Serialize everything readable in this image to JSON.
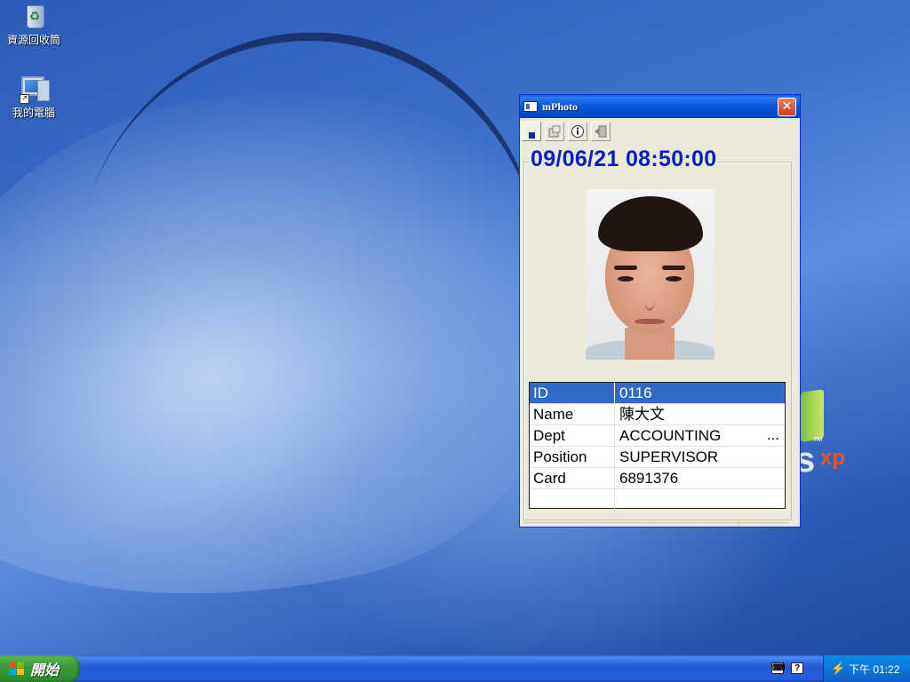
{
  "desktop": {
    "icons": [
      {
        "label": "資源回收筒",
        "icon": "recycle-bin-icon"
      },
      {
        "label": "我的電腦",
        "icon": "my-computer-icon"
      }
    ]
  },
  "window": {
    "title": "mPhoto",
    "close_symbol": "✕",
    "toolbar": {
      "buttons": [
        {
          "icon": "blue-square-icon"
        },
        {
          "icon": "settings-icon"
        },
        {
          "icon": "info-icon"
        },
        {
          "icon": "exit-icon"
        }
      ]
    },
    "datetime": "09/06/21 08:50:00",
    "record": {
      "rows": [
        {
          "key": "ID",
          "value": "0116",
          "selected": true
        },
        {
          "key": "Name",
          "value": "陳大文"
        },
        {
          "key": "Dept",
          "value": "ACCOUNTING",
          "extra": "..."
        },
        {
          "key": "Position",
          "value": "SUPERVISOR"
        },
        {
          "key": "Card",
          "value": "6891376"
        }
      ]
    }
  },
  "taskbar": {
    "start_label": "開始",
    "clock": "下午 01:22",
    "tray_icons": [
      "keyboard-icon",
      "help-icon",
      "network-icon"
    ]
  },
  "colors": {
    "clock_text": "#0b1fc8",
    "selection": "#316ac5",
    "title_bar": "#0a55d8",
    "taskbar": "#245edb",
    "start_button": "#3c9a3c"
  }
}
